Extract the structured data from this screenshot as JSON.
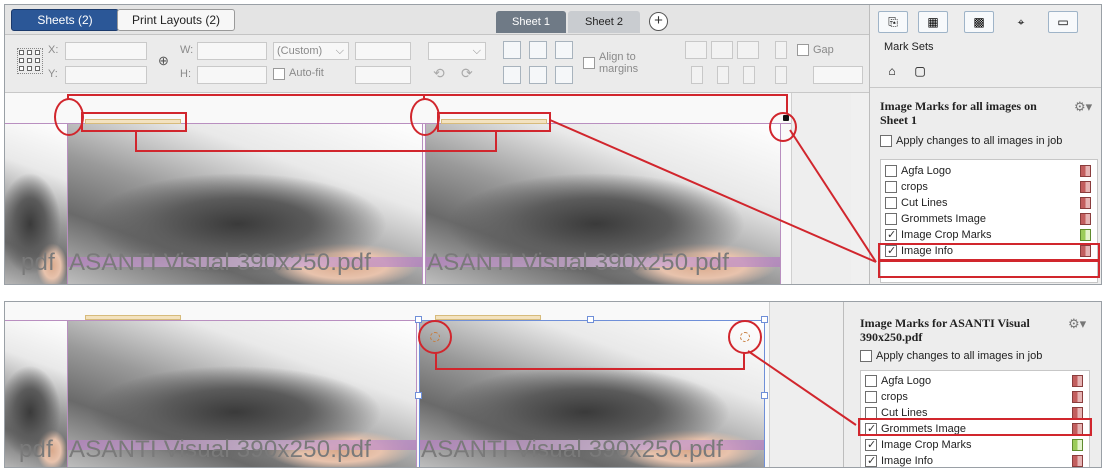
{
  "top": {
    "layout_tabs": [
      {
        "label": "Sheets (2)",
        "active": true
      },
      {
        "label": "Print Layouts (2)",
        "active": false
      }
    ],
    "sheet_tabs": [
      {
        "label": "Sheet 1",
        "active": true
      },
      {
        "label": "Sheet 2",
        "active": false
      }
    ],
    "add_sheet_label": "+",
    "toolbar": {
      "x_label": "X:",
      "y_label": "Y:",
      "w_label": "W:",
      "h_label": "H:",
      "scale_value": "(Custom)",
      "autofit_label": "Auto-fit",
      "align_to_margins_label": "Align to margins",
      "gap_label": "Gap"
    },
    "captions": [
      "pdf",
      "ASANTI Visual 390x250.pdf",
      "ASANTI Visual 390x250.pdf"
    ],
    "panel": {
      "tab_title": "Mark Sets",
      "title": "Image Marks for all images on Sheet 1",
      "apply_label": "Apply changes to all images in job",
      "marks": [
        {
          "label": "Agfa Logo",
          "checked": false,
          "color": "red"
        },
        {
          "label": "crops",
          "checked": false,
          "color": "red"
        },
        {
          "label": "Cut Lines",
          "checked": false,
          "color": "red"
        },
        {
          "label": "Grommets Image",
          "checked": false,
          "color": "red"
        },
        {
          "label": "Image Crop Marks",
          "checked": true,
          "color": "green"
        },
        {
          "label": "Image Info",
          "checked": true,
          "color": "red"
        }
      ]
    }
  },
  "bottom": {
    "captions": [
      "pdf",
      "ASANTI Visual 390x250.pdf",
      "ASANTI Visual 390x250.pdf"
    ],
    "panel": {
      "title": "Image Marks for ASANTI Visual 390x250.pdf",
      "apply_label": "Apply changes to all images in job",
      "marks": [
        {
          "label": "Agfa Logo",
          "checked": false,
          "color": "red"
        },
        {
          "label": "crops",
          "checked": false,
          "color": "red"
        },
        {
          "label": "Cut Lines",
          "checked": false,
          "color": "red"
        },
        {
          "label": "Grommets Image",
          "checked": true,
          "color": "red"
        },
        {
          "label": "Image Crop Marks",
          "checked": true,
          "color": "green"
        },
        {
          "label": "Image Info",
          "checked": true,
          "color": "red"
        }
      ]
    }
  },
  "colors": {
    "highlight": "#d1262d",
    "active_tab": "#2b5797",
    "sheet_tab_active": "#6f7a86"
  }
}
